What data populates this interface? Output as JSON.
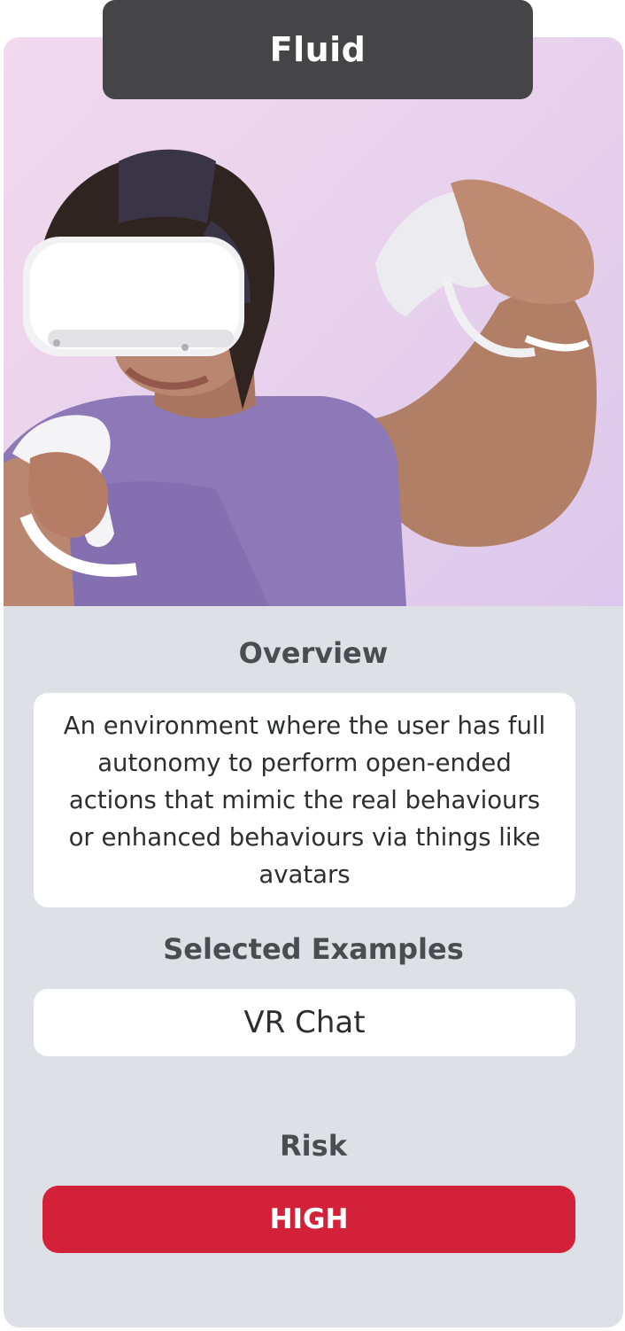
{
  "card": {
    "title": "Fluid",
    "image_alt": "Person wearing a white VR headset holding two VR controllers"
  },
  "overview": {
    "heading": "Overview",
    "text": "An environment where the user has full autonomy to perform open-ended actions that mimic the real behaviours or enhanced behaviours via things like avatars"
  },
  "examples": {
    "heading": "Selected Examples",
    "items": [
      "VR Chat"
    ]
  },
  "risk": {
    "heading": "Risk",
    "level": "HIGH",
    "color": "#d4213a"
  },
  "colors": {
    "title_tab": "#454547",
    "card_bg": "#dde0e4",
    "heading_text": "#4a4c50"
  }
}
